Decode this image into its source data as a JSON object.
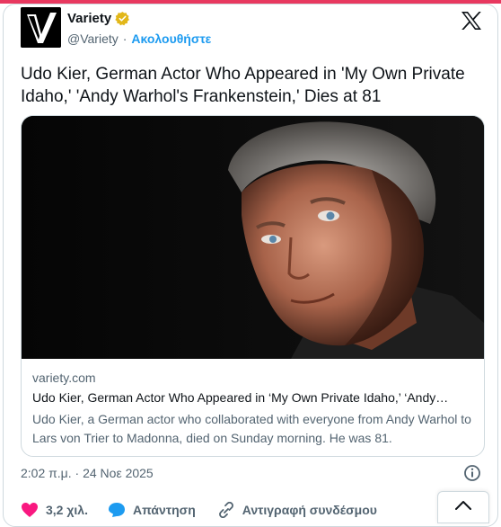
{
  "account": {
    "name": "Variety",
    "handle": "@Variety",
    "follow_label": "Ακολουθήστε"
  },
  "tweet": {
    "headline": "Udo Kier, German Actor Who Appeared in 'My Own Private Idaho,' 'Andy Warhol's Frankenstein,' Dies at 81",
    "timestamp": "2:02 π.μ. · 24 Νοε 2025"
  },
  "link_card": {
    "domain": "variety.com",
    "title": "Udo Kier, German Actor Who Appeared in ‘My Own Private Idaho,’ ‘Andy…",
    "description": "Udo Kier, a German actor who collaborated with everyone from Andy Warhol to Lars von Trier to Madonna, died on Sunday morning. He was 81."
  },
  "actions": {
    "likes": "3,2 χιλ.",
    "reply": "Απάντηση",
    "copy_link": "Αντιγραφή συνδέσμου"
  },
  "colors": {
    "accent": "#1d9bf0",
    "like": "#f91880",
    "verified": "#e2b719"
  },
  "icons": [
    "verified-badge-icon",
    "x-logo-icon",
    "info-icon",
    "heart-icon",
    "reply-icon",
    "link-icon",
    "chevron-up-icon"
  ]
}
